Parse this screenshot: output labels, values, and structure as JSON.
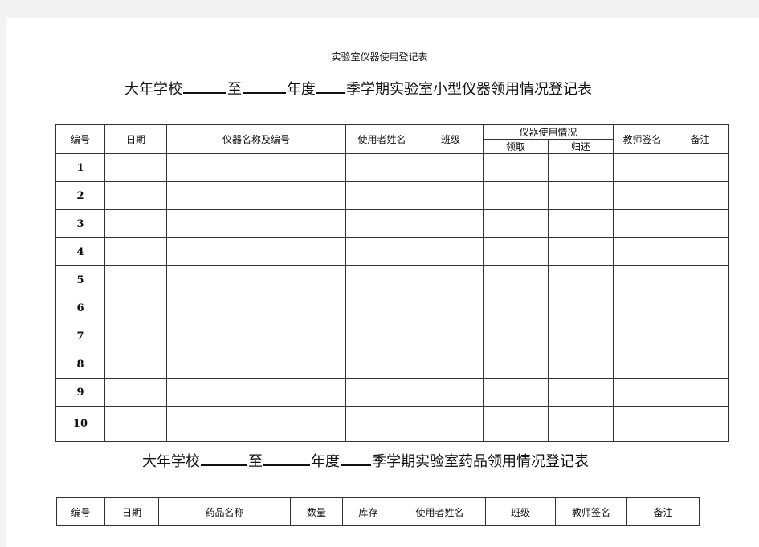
{
  "document": {
    "title": "实验室仪器使用登记表"
  },
  "instrument_form": {
    "heading": {
      "part1": "大年学校",
      "part2": "至",
      "part3": "年度",
      "part4": "季学期实验室小型仪器领用情况登记表"
    },
    "columns": {
      "number": "编号",
      "date": "日期",
      "instrument_name": "仪器名称及编号",
      "user_name": "使用者姓名",
      "class": "班级",
      "usage_group": "仪器使用情况",
      "borrow": "领取",
      "return": "归还",
      "teacher_signature": "教师签名",
      "remarks": "备注"
    },
    "rows": [
      "1",
      "2",
      "3",
      "4",
      "5",
      "6",
      "7",
      "8",
      "9",
      "10"
    ]
  },
  "chemical_form": {
    "heading": {
      "part1": "大年学校",
      "part2": "至",
      "part3": "年度",
      "part4": "季学期实验室药品领用情况登记表"
    },
    "columns": {
      "number": "编号",
      "date": "日期",
      "chemical_name": "药品名称",
      "quantity": "数量",
      "stock": "库存",
      "user_name": "使用者姓名",
      "class": "班级",
      "teacher_signature": "教师签名",
      "remarks": "备注"
    }
  }
}
